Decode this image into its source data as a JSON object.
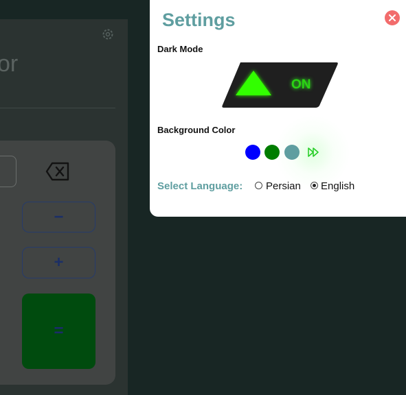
{
  "calculator": {
    "title_partial": "or",
    "keys": {
      "minus": "−",
      "plus": "+",
      "equals": "="
    }
  },
  "settings": {
    "title": "Settings",
    "dark_mode": {
      "label": "Dark Mode",
      "state": "ON"
    },
    "background_color": {
      "label": "Background Color",
      "options": [
        "#0000ff",
        "#007d00",
        "#5f9ea0"
      ]
    },
    "language": {
      "label": "Select Language:",
      "options": [
        "Persian",
        "English"
      ],
      "selected": "English"
    }
  },
  "colors": {
    "accent": "#5f9ea0",
    "toggle_on": "#2bd413",
    "close": "#f26c6c"
  }
}
